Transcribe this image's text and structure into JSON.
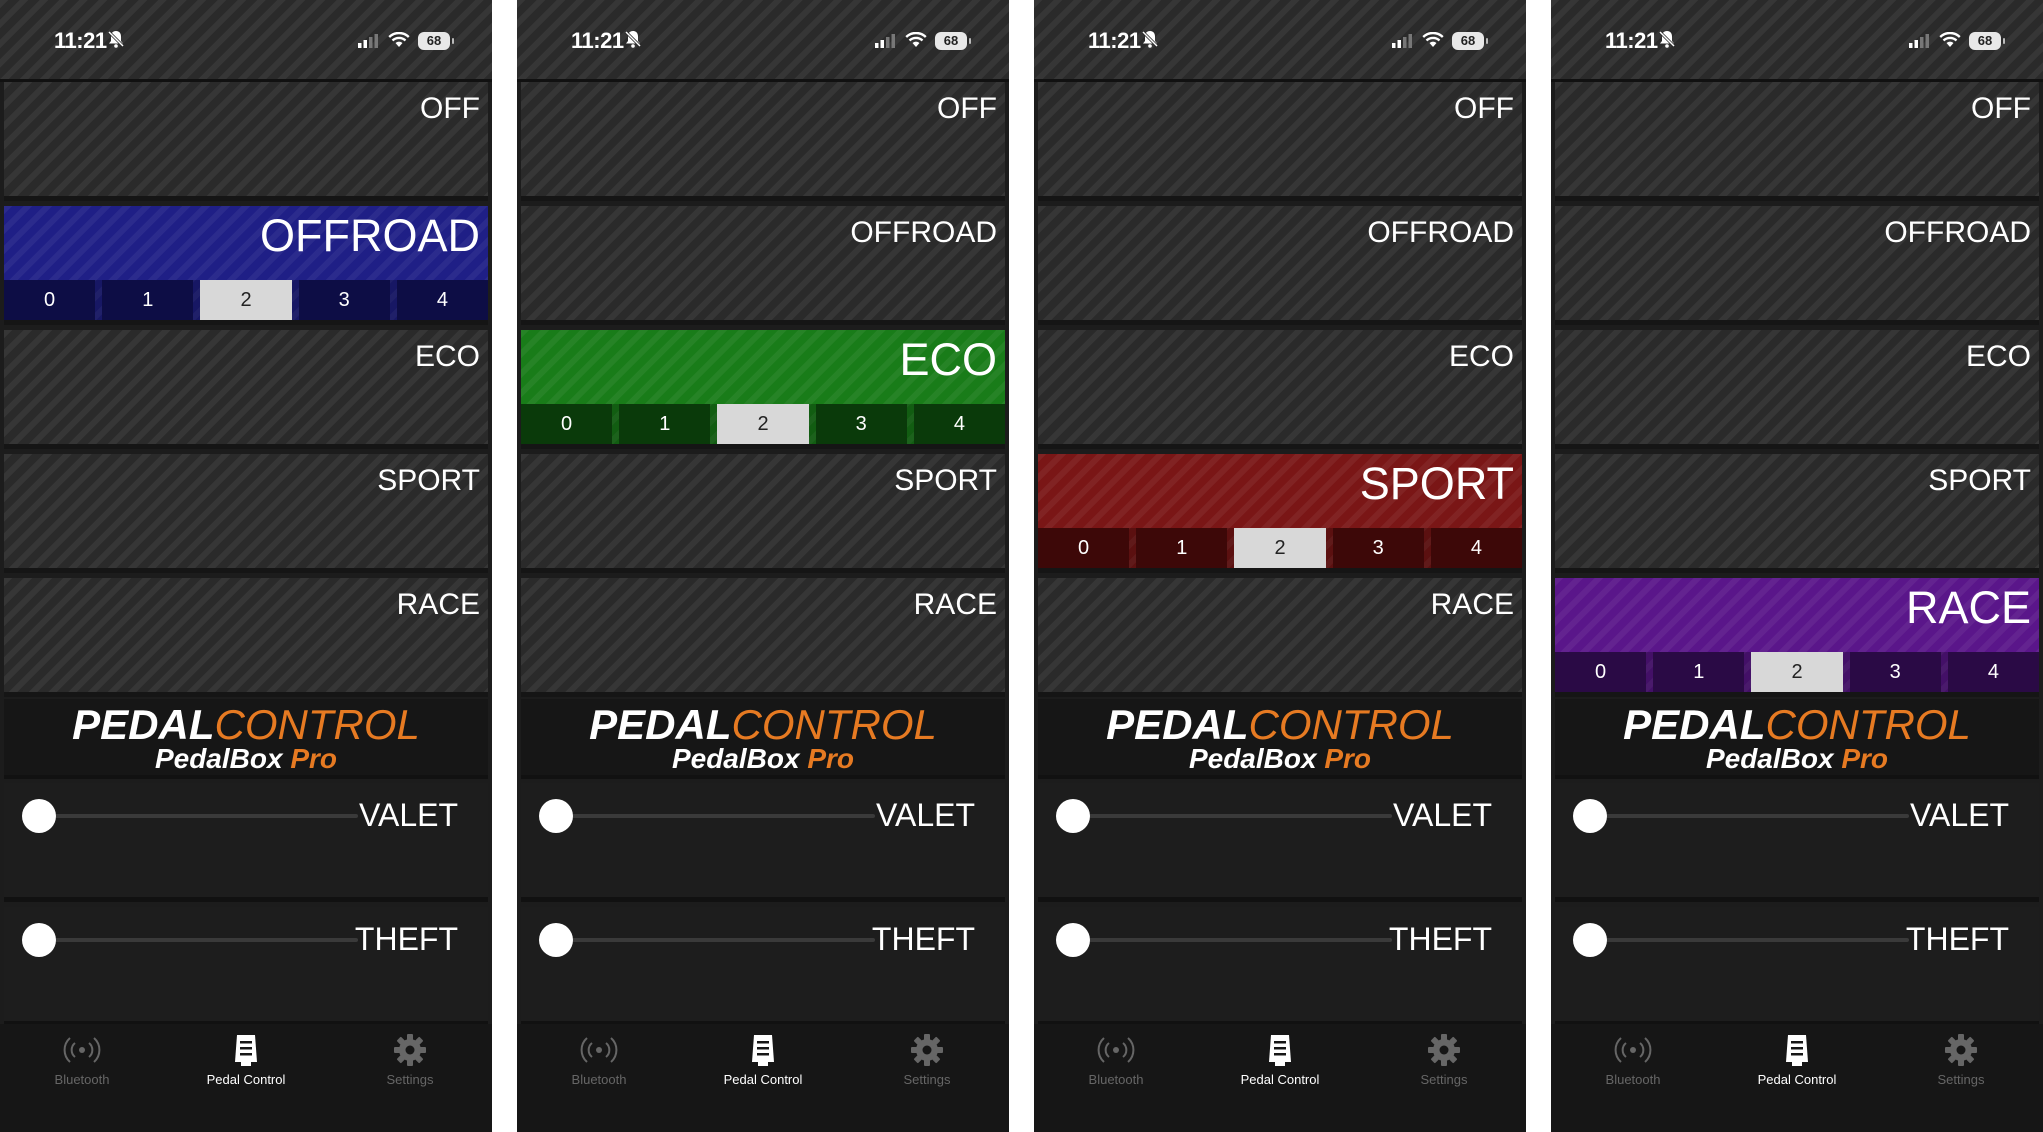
{
  "status": {
    "time": "11:21",
    "battery": "68"
  },
  "modes": [
    "OFF",
    "OFFROAD",
    "ECO",
    "SPORT",
    "RACE"
  ],
  "levels": [
    "0",
    "1",
    "2",
    "3",
    "4"
  ],
  "brand": {
    "pedal": "PEDAL",
    "control": "CONTROL",
    "sub_main": "PedalBox ",
    "sub_pro": "Pro"
  },
  "toggles": {
    "valet": "VALET",
    "theft": "THEFT"
  },
  "tabs": {
    "bluetooth": "Bluetooth",
    "pedal_control": "Pedal Control",
    "settings": "Settings"
  },
  "screens": [
    {
      "active_mode": "OFFROAD",
      "selected_level": "2"
    },
    {
      "active_mode": "ECO",
      "selected_level": "2"
    },
    {
      "active_mode": "SPORT",
      "selected_level": "2"
    },
    {
      "active_mode": "RACE",
      "selected_level": "2"
    }
  ],
  "colors": {
    "offroad": "#1f1f86",
    "eco": "#197c19",
    "sport": "#7a1616",
    "race": "#5a168a",
    "brand_accent": "#e67a22"
  },
  "icons": [
    "bell-slash-icon",
    "cellular-signal-icon",
    "wifi-icon",
    "battery-icon",
    "bluetooth-icon",
    "pedal-icon",
    "gear-icon"
  ]
}
